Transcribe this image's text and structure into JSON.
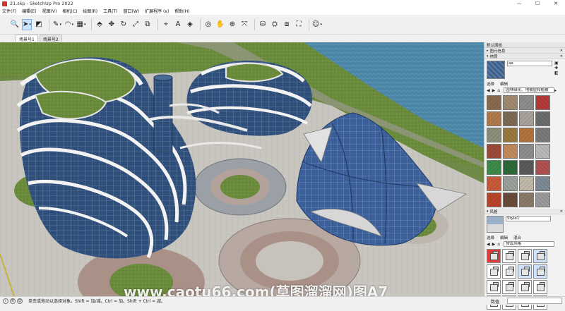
{
  "window": {
    "title": "21.skp - SketchUp Pro 2022",
    "minimize": "—",
    "maximize": "☐",
    "close": "✕"
  },
  "menu": [
    "文件(F)",
    "编辑(E)",
    "视图(V)",
    "相机(C)",
    "绘图(R)",
    "工具(T)",
    "窗口(W)",
    "扩展程序 (x)",
    "帮助(H)"
  ],
  "scenes": [
    "场景号1",
    "场景号2"
  ],
  "tray": {
    "title": "默认面板",
    "info_panel": "图元信息",
    "materials": {
      "header": "材质",
      "current_name": "aa",
      "tab_select": "选择",
      "tab_edit": "编辑",
      "library": "园林绿化、地被层和植被"
    },
    "styles": {
      "header": "风格",
      "current_name": "Style1",
      "tab_select": "选择",
      "tab_edit": "编辑",
      "tab_mix": "混合",
      "library": "预设风格"
    }
  },
  "status": {
    "hint": "单击或拖动以选择对象。Shift = 加/减。Ctrl = 加。Shift + Ctrl = 减。",
    "vcb_label": "数值"
  },
  "watermark": "www.caotu66.com(草图溜溜网)图A7",
  "material_colors": [
    "#8a6a4f",
    "#a08a70",
    "#8d8d8d",
    "#b53a3a",
    "#b07a4a",
    "#7c6a55",
    "#a9a29a",
    "#6c6c6c",
    "#8e8e7c",
    "#9a7a3c",
    "#b2743c",
    "#7a7a7a",
    "#9c4a3a",
    "#c08a5a",
    "#8d8d8d",
    "#b8b8b8",
    "#3e8a4a",
    "#2c6a3a",
    "#5a5a5a",
    "#b05050",
    "#c85a3c",
    "#9aa09a",
    "#c0b8a8",
    "#7c8a96",
    "#b8442c",
    "#6a4a3a",
    "#8a7a6a",
    "#9a9a9a"
  ],
  "style_colors": [
    "#e23b3b",
    "#ffffff",
    "#ffffff",
    "#cfe3ff",
    "#ffffff",
    "#ffffff",
    "#cfe3ff",
    "#cfe3ff",
    "#ffffff",
    "#ffffff",
    "#ffffff",
    "#ffffff",
    "#ffffff",
    "#ffffff",
    "#ffffff",
    "#ffffff"
  ]
}
